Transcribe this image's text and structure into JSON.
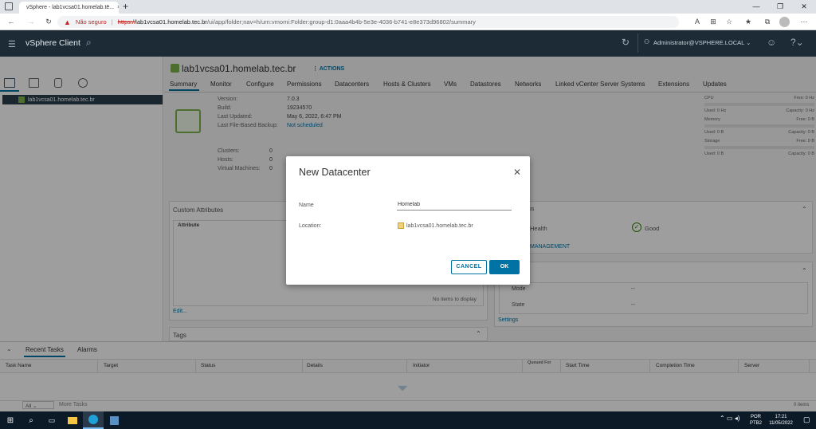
{
  "browser": {
    "tab_title": "vSphere - lab1vcsa01.homelab.tē...",
    "insecure_label": "Não seguro",
    "url_scheme": "https://",
    "url_host": "lab1vcsa01.homelab.tec.br",
    "url_path": "/ui/app/folder;nav=h/urn:vmomi:Folder:group-d1:0aaa4b4b-5e3e-4036-b741-e8e373d96802/summary"
  },
  "header": {
    "app_title": "vSphere Client",
    "user": "Administrator@VSPHERE.LOCAL"
  },
  "tree": {
    "selected_item": "lab1vcsa01.homelab.tec.br"
  },
  "object": {
    "title": "lab1vcsa01.homelab.tec.br",
    "actions_label": "ACTIONS",
    "tabs": [
      "Summary",
      "Monitor",
      "Configure",
      "Permissions",
      "Datacenters",
      "Hosts & Clusters",
      "VMs",
      "Datastores",
      "Networks",
      "Linked vCenter Server Systems",
      "Extensions",
      "Updates"
    ]
  },
  "summary": {
    "version_label": "Version:",
    "version_value": "7.0.3",
    "build_label": "Build:",
    "build_value": "19234570",
    "last_updated_label": "Last Updated:",
    "last_updated_value": "May 6, 2022, 6:47 PM",
    "backup_label": "Last File-Based Backup:",
    "backup_value": "Not scheduled",
    "clusters_label": "Clusters:",
    "clusters_value": "0",
    "hosts_label": "Hosts:",
    "hosts_value": "0",
    "vms_label": "Virtual Machines:",
    "vms_value": "0"
  },
  "resources": {
    "cpu_label": "CPU",
    "cpu_free": "Free: 0 Hz",
    "cpu_used": "Used: 0 Hz",
    "cpu_capacity": "Capacity: 0 Hz",
    "memory_label": "Memory",
    "memory_free": "Free: 0 B",
    "memory_used": "Used: 0 B",
    "memory_capacity": "Capacity: 0 B",
    "storage_label": "Storage",
    "storage_free": "Free: 0 B",
    "storage_used": "Used: 0 B",
    "storage_capacity": "Capacity: 0 B"
  },
  "custom_attributes": {
    "title": "Custom Attributes",
    "col_attribute": "Attribute",
    "no_items": "No items to display",
    "edit_label": "Edit..."
  },
  "tags": {
    "title": "Tags"
  },
  "status_card": {
    "title_suffix": "us",
    "health_label": "Health",
    "health_value": "Good",
    "management_label": "MANAGEMENT"
  },
  "mode_card": {
    "mode_label": "Mode",
    "mode_value": "--",
    "state_label": "State",
    "state_value": "--",
    "settings_label": "Settings"
  },
  "dialog": {
    "title": "New Datacenter",
    "name_label": "Name",
    "name_value": "Homelab",
    "location_label": "Location:",
    "location_value": "lab1vcsa01.homelab.tec.br",
    "cancel_label": "CANCEL",
    "ok_label": "OK"
  },
  "tasks": {
    "tab_recent": "Recent Tasks",
    "tab_alarms": "Alarms",
    "columns": [
      "Task Name",
      "Target",
      "Status",
      "Details",
      "Initiator",
      "Queued For",
      "Start Time",
      "Completion Time",
      "Server"
    ],
    "filter_value": "All",
    "more_tasks": "More Tasks",
    "items_count": "0 items"
  },
  "taskbar": {
    "lang_1": "POR",
    "lang_2": "PTB2",
    "time": "17:21",
    "date": "11/05/2022"
  },
  "colors": {
    "accent": "#0072a3",
    "header_bg": "#1c2b36",
    "insecure": "#c5221f",
    "good": "#2f8400"
  }
}
